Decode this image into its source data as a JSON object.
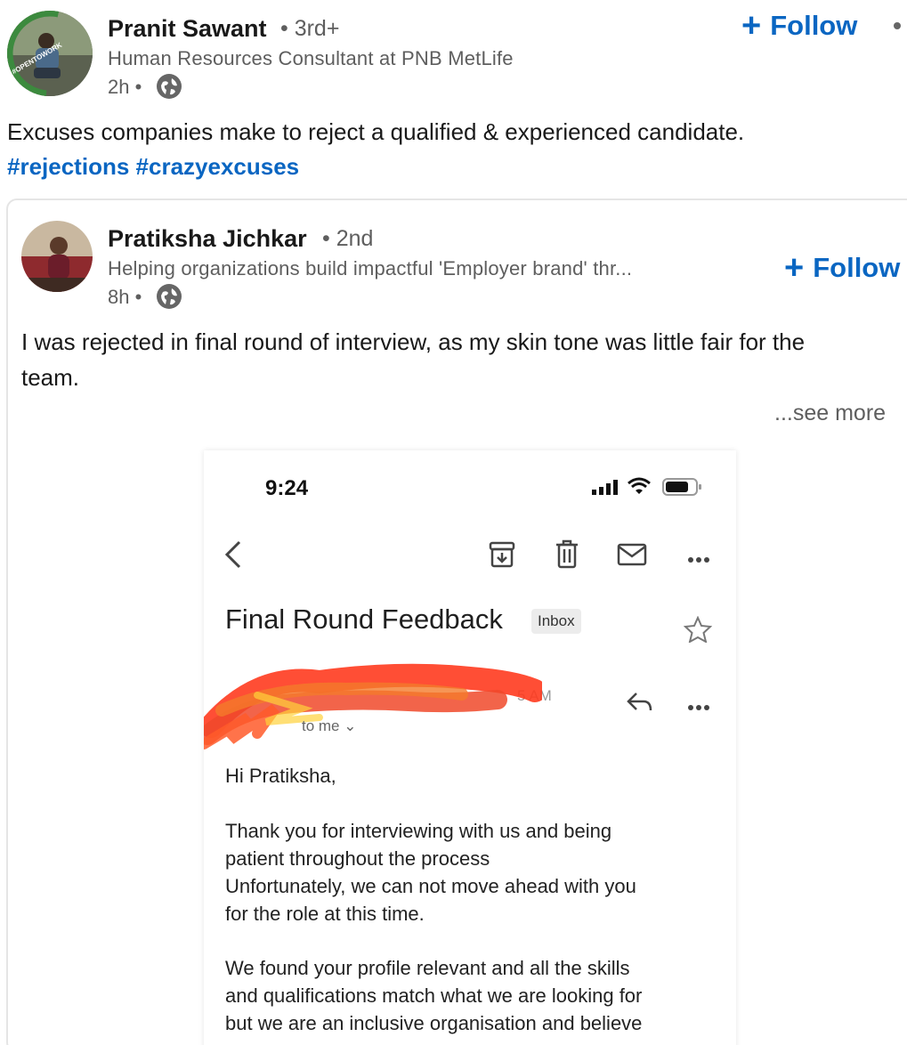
{
  "post": {
    "author_name": "Pranit Sawant",
    "author_degree": "• 3rd+",
    "author_headline": "Human Resources Consultant at PNB MetLife",
    "time": "2h •",
    "follow_label": "Follow",
    "text": "Excuses companies make to reject a qualified & experienced candidate.",
    "hashtags": [
      "#rejections",
      "#crazyexcuses"
    ],
    "avatar_badge": "#OPENTOWORK"
  },
  "reshared": {
    "author_name": "Pratiksha Jichkar",
    "author_degree": "• 2nd",
    "author_headline": "Helping organizations build impactful 'Employer brand' thr...",
    "time": "8h •",
    "follow_label": "Follow",
    "text_line1": "I was rejected in final round of interview, as my skin tone was little fair for the",
    "text_line2": "team.",
    "see_more": "...see more"
  },
  "email": {
    "status_time": "9:24",
    "subject": "Final Round Feedback",
    "badge": "Inbox",
    "header_time_fragment": "5 AM",
    "to_me": "to me",
    "greeting": "Hi Pratiksha,",
    "para1": [
      "Thank you for interviewing with us and being",
      "patient throughout the process",
      "Unfortunately, we can not move ahead with you",
      "for the role at this time."
    ],
    "para2": [
      "We found your profile relevant and all the skills",
      "and qualifications match what we are looking for",
      "but we are an inclusive organisation and believe"
    ]
  }
}
